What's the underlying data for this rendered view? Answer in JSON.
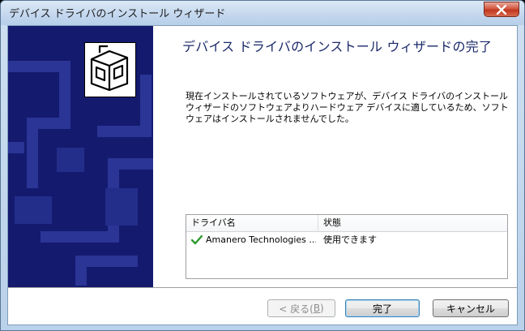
{
  "window": {
    "title": "デバイス ドライバのインストール ウィザード"
  },
  "content": {
    "heading": "デバイス ドライバのインストール ウィザードの完了",
    "message": "現在インストールされているソフトウェアが、デバイス ドライバのインストール ウィザードのソフトウェアよりハードウェア デバイスに適しているため、ソフトウェアはインストールされませんでした。"
  },
  "driver_list": {
    "columns": [
      "ドライバ名",
      "状態"
    ],
    "rows": [
      {
        "name": "Amanero Technologies ...",
        "status": "使用できます",
        "icon": "checkmark-icon"
      }
    ]
  },
  "buttons": {
    "back": {
      "label": "< 戻る(",
      "mnemonic": "B",
      "suffix": ")"
    },
    "finish": "完了",
    "cancel": "キャンセル"
  },
  "colors": {
    "banner": "#141a6e",
    "heading": "#1b2a6a",
    "check": "#2e9a2e"
  }
}
